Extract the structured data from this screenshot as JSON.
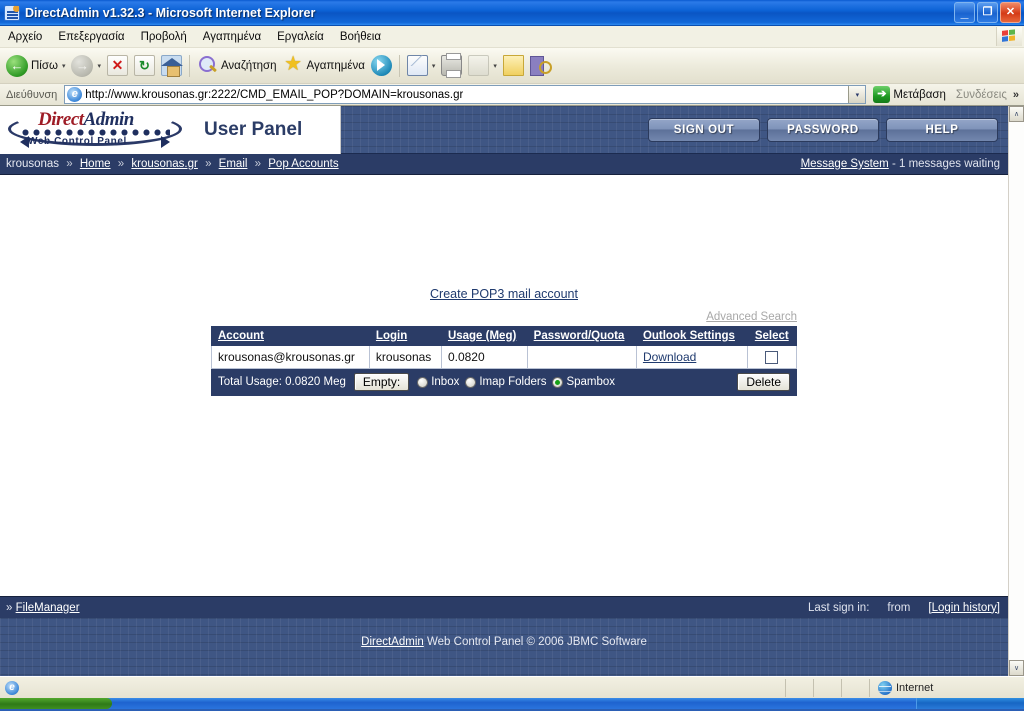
{
  "window": {
    "title": "DirectAdmin v1.32.3 - Microsoft Internet Explorer",
    "minimize_label": "_",
    "restore_label": "❐",
    "close_label": "✕"
  },
  "menubar": {
    "items": [
      {
        "label": "Αρχείο"
      },
      {
        "label": "Επεξεργασία"
      },
      {
        "label": "Προβολή"
      },
      {
        "label": "Αγαπημένα"
      },
      {
        "label": "Εργαλεία"
      },
      {
        "label": "Βοήθεια"
      }
    ]
  },
  "toolbar": {
    "back_label": "Πίσω",
    "search_label": "Αναζήτηση",
    "favorites_label": "Αγαπημένα",
    "dropdown_glyph": "▾",
    "back_glyph": "←",
    "forward_glyph": "→",
    "stop_glyph": "✕",
    "refresh_glyph": "↻",
    "star_glyph": "★"
  },
  "address": {
    "label": "Διεύθυνση",
    "url": "http://www.krousonas.gr:2222/CMD_EMAIL_POP?DOMAIN=krousonas.gr",
    "dropdown_glyph": "▾",
    "go_label": "Μετάβαση",
    "go_glyph": "➔",
    "links_label": "Συνδέσεις",
    "chevron": "»"
  },
  "app_header": {
    "logo_title_direct": "Direct",
    "logo_title_admin": "Admin",
    "logo_subtitle": "Web Control Panel",
    "panel_title": "User Panel",
    "buttons": [
      {
        "label": "SIGN OUT"
      },
      {
        "label": "PASSWORD"
      },
      {
        "label": "HELP"
      }
    ]
  },
  "breadcrumb": {
    "root": "krousonas",
    "separator": "»",
    "items": [
      {
        "label": "Home"
      },
      {
        "label": "krousonas.gr"
      },
      {
        "label": "Email"
      },
      {
        "label": "Pop Accounts"
      }
    ],
    "message_link": "Message System",
    "message_text": "- 1 messages waiting"
  },
  "main": {
    "create_link": "Create POP3 mail account",
    "advanced_search": "Advanced Search",
    "table": {
      "headers": [
        "Account",
        "Login",
        "Usage (Meg)",
        "Password/Quota",
        "Outlook Settings",
        "Select"
      ],
      "rows": [
        {
          "account": "krousonas@krousonas.gr",
          "login": "krousonas",
          "usage": "0.0820",
          "password_quota": "",
          "outlook": "Download",
          "selected": false
        }
      ]
    },
    "total_bar": {
      "total_label": "Total Usage: 0.0820 Meg",
      "empty_label": "Empty:",
      "radios": [
        {
          "label": "Inbox",
          "selected": false
        },
        {
          "label": "Imap Folders",
          "selected": false
        },
        {
          "label": "Spambox",
          "selected": true
        }
      ],
      "delete_label": "Delete"
    }
  },
  "footer": {
    "chevron": "»",
    "filemanager_label": "FileManager",
    "last_sign_in_label": "Last sign in:",
    "from_label": "from",
    "login_history_label": "[Login history]",
    "copyright_link": "DirectAdmin",
    "copyright_text": "Web Control Panel ©  2006 JBMC Software"
  },
  "scrollbar": {
    "up_glyph": "∧",
    "down_glyph": "∨"
  },
  "statusbar": {
    "zone_label": "Internet"
  },
  "colors": {
    "accent_navy": "#2b3c66",
    "panel_bg": "#3f5684",
    "link": "#1f3a6e",
    "radio_on": "#17a017",
    "brand_red": "#9e1c26"
  }
}
